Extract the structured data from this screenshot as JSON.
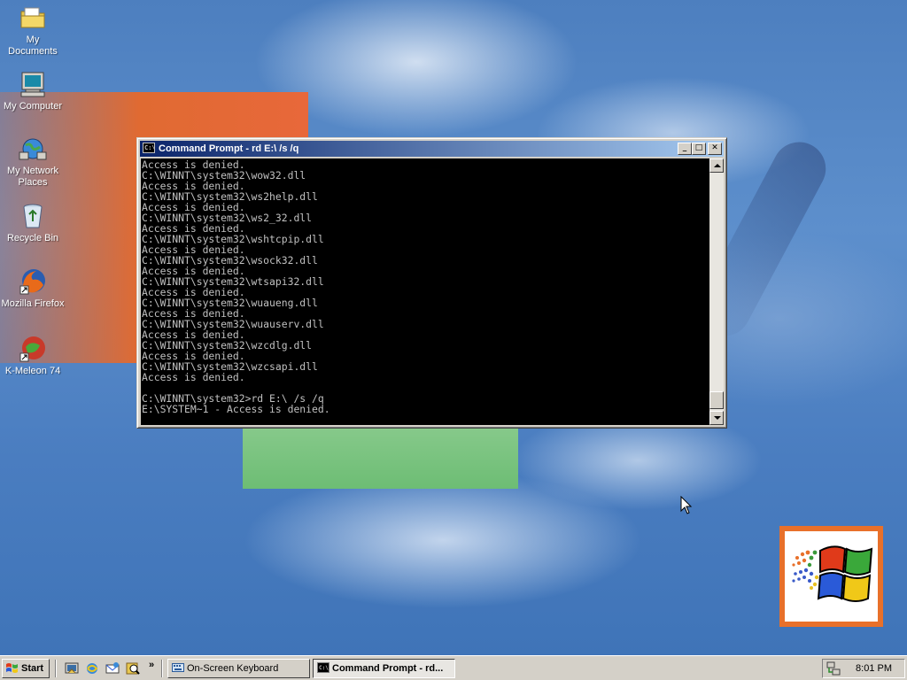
{
  "desktop": {
    "icons": [
      {
        "label": "My Documents"
      },
      {
        "label": "My Computer"
      },
      {
        "label_line1": "My Network",
        "label_line2": "Places"
      },
      {
        "label": "Recycle Bin"
      },
      {
        "label": "Mozilla Firefox"
      },
      {
        "label": "K-Meleon 74"
      }
    ]
  },
  "cmd_window": {
    "title": "Command Prompt - rd E:\\ /s /q",
    "icon_text": "C:\\",
    "console_text": "Access is denied.\nC:\\WINNT\\system32\\wow32.dll\nAccess is denied.\nC:\\WINNT\\system32\\ws2help.dll\nAccess is denied.\nC:\\WINNT\\system32\\ws2_32.dll\nAccess is denied.\nC:\\WINNT\\system32\\wshtcpip.dll\nAccess is denied.\nC:\\WINNT\\system32\\wsock32.dll\nAccess is denied.\nC:\\WINNT\\system32\\wtsapi32.dll\nAccess is denied.\nC:\\WINNT\\system32\\wuaueng.dll\nAccess is denied.\nC:\\WINNT\\system32\\wuauserv.dll\nAccess is denied.\nC:\\WINNT\\system32\\wzcdlg.dll\nAccess is denied.\nC:\\WINNT\\system32\\wzcsapi.dll\nAccess is denied.\n\nC:\\WINNT\\system32>rd E:\\ /s /q\nE:\\SYSTEM~1 - Access is denied.",
    "buttons": {
      "minimize": "_",
      "maximize": "□",
      "close": "✕"
    }
  },
  "taskbar": {
    "start_label": "Start",
    "quick_launch_more": "»",
    "tasks": [
      {
        "label": "On-Screen Keyboard",
        "active": false
      },
      {
        "label": "Command Prompt - rd...",
        "active": true
      }
    ],
    "clock": "8:01 PM"
  },
  "colors": {
    "titlebar_start": "#0a246a",
    "titlebar_end": "#a6caf0",
    "desktop_blue": "#3a6ea5",
    "console_bg": "#000000",
    "console_fg": "#c0c0c0"
  },
  "icons": [
    "folder-icon",
    "computer-icon",
    "network-icon",
    "recycle-bin-icon",
    "firefox-icon",
    "kmeleon-icon",
    "windows-flag-icon",
    "cmd-icon",
    "keyboard-icon",
    "network-tray-icon"
  ]
}
